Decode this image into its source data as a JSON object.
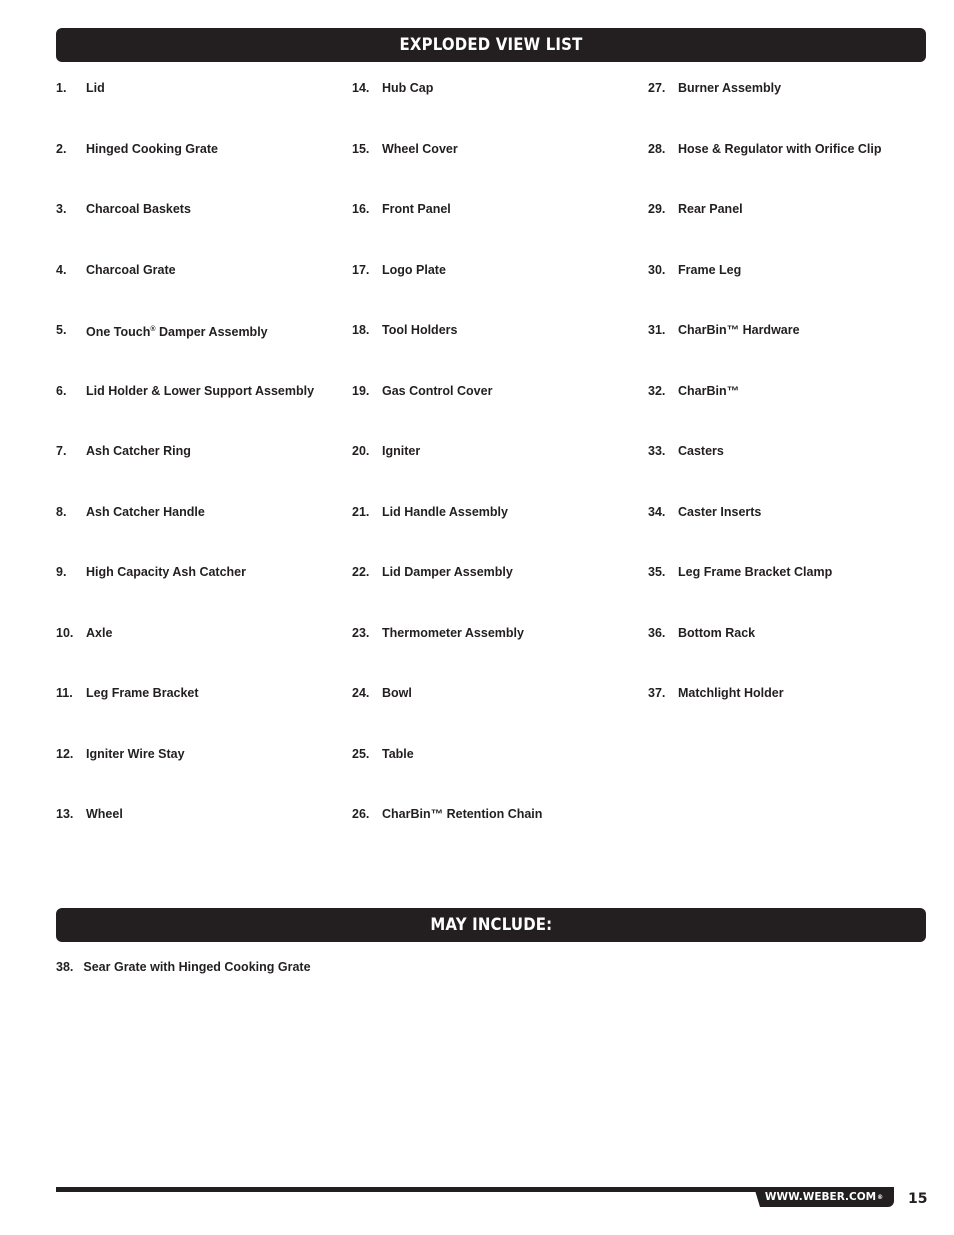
{
  "sections": {
    "exploded_view": {
      "title": "EXPLODED VIEW LIST",
      "columns": [
        [
          {
            "num": "1.",
            "label": "Lid"
          },
          {
            "num": "2.",
            "label": "Hinged Cooking Grate"
          },
          {
            "num": "3.",
            "label": "Charcoal Baskets"
          },
          {
            "num": "4.",
            "label": "Charcoal Grate"
          },
          {
            "num": "5.",
            "label": "One Touch® Damper Assembly"
          },
          {
            "num": "6.",
            "label": "Lid Holder & Lower Support Assembly"
          },
          {
            "num": "7.",
            "label": "Ash Catcher Ring"
          },
          {
            "num": "8.",
            "label": "Ash Catcher Handle"
          },
          {
            "num": "9.",
            "label": "High Capacity Ash Catcher"
          },
          {
            "num": "10.",
            "label": "Axle"
          },
          {
            "num": "11.",
            "label": "Leg Frame Bracket"
          },
          {
            "num": "12.",
            "label": "Igniter Wire Stay"
          },
          {
            "num": "13.",
            "label": "Wheel"
          }
        ],
        [
          {
            "num": "14.",
            "label": "Hub Cap"
          },
          {
            "num": "15.",
            "label": "Wheel Cover"
          },
          {
            "num": "16.",
            "label": "Front Panel"
          },
          {
            "num": "17.",
            "label": "Logo Plate"
          },
          {
            "num": "18.",
            "label": "Tool Holders"
          },
          {
            "num": "19.",
            "label": "Gas Control Cover"
          },
          {
            "num": "20.",
            "label": "Igniter"
          },
          {
            "num": "21.",
            "label": "Lid Handle Assembly"
          },
          {
            "num": "22.",
            "label": "Lid Damper Assembly"
          },
          {
            "num": "23.",
            "label": "Thermometer Assembly"
          },
          {
            "num": "24.",
            "label": "Bowl"
          },
          {
            "num": "25.",
            "label": "Table"
          },
          {
            "num": "26.",
            "label": "CharBin™ Retention Chain"
          }
        ],
        [
          {
            "num": "27.",
            "label": "Burner Assembly"
          },
          {
            "num": "28.",
            "label": "Hose & Regulator with Orifice Clip"
          },
          {
            "num": "29.",
            "label": "Rear Panel"
          },
          {
            "num": "30.",
            "label": "Frame Leg"
          },
          {
            "num": "31.",
            "label": "CharBin™ Hardware"
          },
          {
            "num": "32.",
            "label": "CharBin™"
          },
          {
            "num": "33.",
            "label": "Casters"
          },
          {
            "num": "34.",
            "label": "Caster Inserts"
          },
          {
            "num": "35.",
            "label": "Leg Frame Bracket Clamp"
          },
          {
            "num": "36.",
            "label": "Bottom Rack"
          },
          {
            "num": "37.",
            "label": "Matchlight Holder"
          }
        ]
      ]
    },
    "may_include": {
      "title": "MAY INCLUDE:",
      "items": [
        {
          "num": "38.",
          "label": "Sear Grate with Hinged Cooking Grate"
        }
      ]
    }
  },
  "footer": {
    "website": "WWW.WEBER.COM",
    "website_mark": "®",
    "page_number": "15"
  }
}
